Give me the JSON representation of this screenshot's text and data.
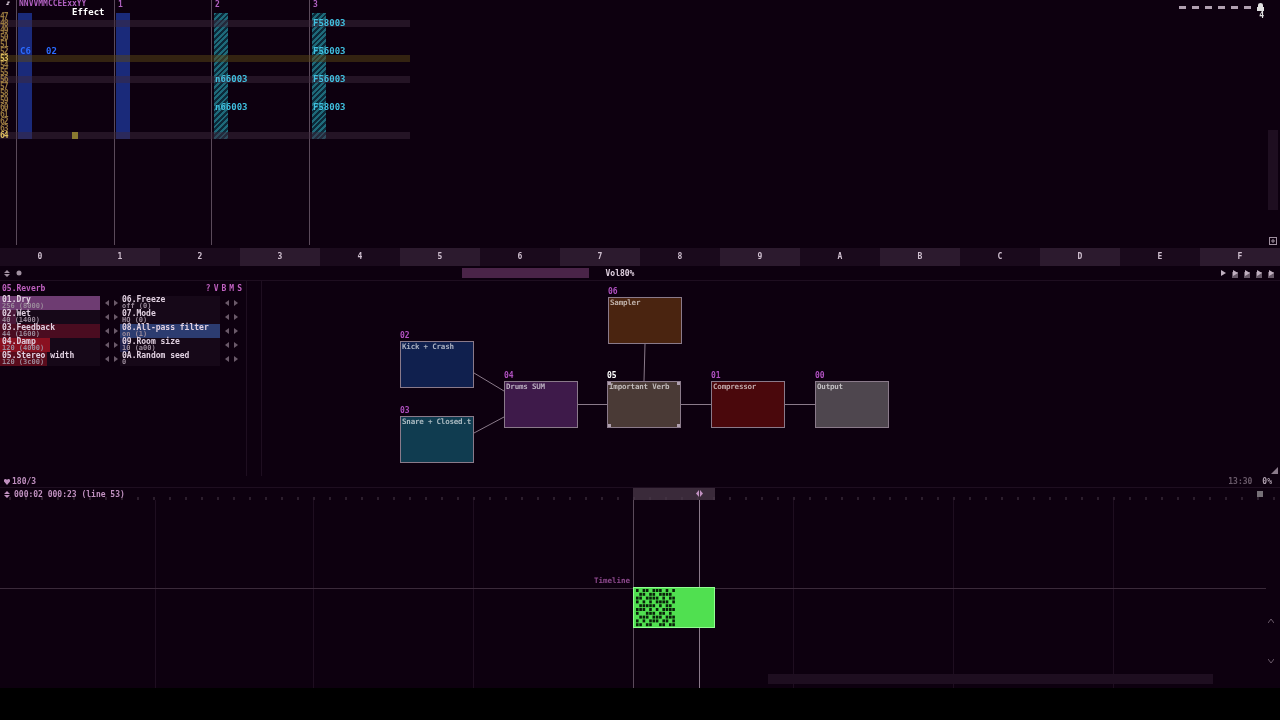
{
  "pattern": {
    "header": "NNVVMMCCEExxYY",
    "tooltip": "Effect",
    "tracks": [
      {
        "kind": "solid"
      },
      {
        "label": "1",
        "kind": "solid"
      },
      {
        "label": "2",
        "kind": "hatched"
      },
      {
        "label": "3",
        "kind": "hatched"
      }
    ],
    "rows": [
      {
        "num": "47",
        "selected": false
      },
      {
        "num": "48",
        "selected": false,
        "t3": "F58003"
      },
      {
        "num": "49",
        "selected": false
      },
      {
        "num": "50",
        "selected": false
      },
      {
        "num": "51",
        "selected": false
      },
      {
        "num": "52",
        "selected": false,
        "t0": {
          "note": "C6",
          "module": "02"
        },
        "t3": "F56003"
      },
      {
        "num": "53",
        "selected": true
      },
      {
        "num": "54",
        "selected": false
      },
      {
        "num": "55",
        "selected": false
      },
      {
        "num": "56",
        "selected": false,
        "t2": "n66003",
        "t3": "F56003"
      },
      {
        "num": "57",
        "selected": false
      },
      {
        "num": "58",
        "selected": false
      },
      {
        "num": "59",
        "selected": false
      },
      {
        "num": "60",
        "selected": false,
        "t2": "n66003",
        "t3": "F58003"
      },
      {
        "num": "61",
        "selected": false
      },
      {
        "num": "62",
        "selected": false
      },
      {
        "num": "63",
        "selected": false
      },
      {
        "num": "64",
        "selected": false
      }
    ]
  },
  "top_right": {
    "counter": "4"
  },
  "track_ruler": [
    "0",
    "1",
    "2",
    "3",
    "4",
    "5",
    "6",
    "7",
    "8",
    "9",
    "A",
    "B",
    "C",
    "D",
    "E",
    "F"
  ],
  "toolbar": {
    "volume": "Vol80%"
  },
  "module": {
    "title": "05.Reverb",
    "flags": [
      "?",
      "V",
      "B",
      "M",
      "S"
    ],
    "params": [
      {
        "name": "01.Dry",
        "value": "256 (8000)",
        "level": 1,
        "color": "#6e3c72"
      },
      {
        "name": "06.Freeze",
        "value": "off (0)"
      },
      {
        "name": "02.Wet",
        "value": "40 (1400)",
        "level": 0.16,
        "color": "#4a1838"
      },
      {
        "name": "07.Mode",
        "value": "HQ (0)"
      },
      {
        "name": "03.Feedback",
        "value": "44 (1600)",
        "level": 1,
        "color": "#4a0c20"
      },
      {
        "name": "08.All-pass filter",
        "value": "on (1)",
        "level": 1,
        "color": "#2c3c70"
      },
      {
        "name": "04.Damp",
        "value": "120 (4000)",
        "level": 0.5,
        "color": "#8a1020"
      },
      {
        "name": "09.Room size",
        "value": "10 (a00)",
        "level": 0.08,
        "color": "#20204a"
      },
      {
        "name": "05.Stereo width",
        "value": "120 (3c00)",
        "level": 0.47,
        "color": "#5a0c1c"
      },
      {
        "name": "0A.Random seed",
        "value": "0"
      }
    ]
  },
  "graph": {
    "nodes": [
      {
        "num": "06",
        "name": "Sampler",
        "color": "#4a2410",
        "selected": false
      },
      {
        "num": "02",
        "name": "Kick + Crash",
        "color": "#10204e",
        "selected": false
      },
      {
        "num": "04",
        "name": "Drums SUM",
        "color": "#3e1a4a",
        "selected": false
      },
      {
        "num": "05",
        "name": "Important Verb",
        "color": "#4a3a36",
        "selected": true
      },
      {
        "num": "01",
        "name": "Compressor",
        "color": "#4a080c",
        "selected": false
      },
      {
        "num": "00",
        "name": "Output",
        "color": "#4e464e",
        "selected": false
      },
      {
        "num": "03",
        "name": "Snare + Closed.t",
        "color": "#103c50",
        "selected": false
      }
    ]
  },
  "timeline": {
    "bpm": "180/3",
    "time": "13:30",
    "cpu": "0%",
    "position": "000:02 000:23 (line 53)",
    "pattern_name": "Timeline"
  }
}
